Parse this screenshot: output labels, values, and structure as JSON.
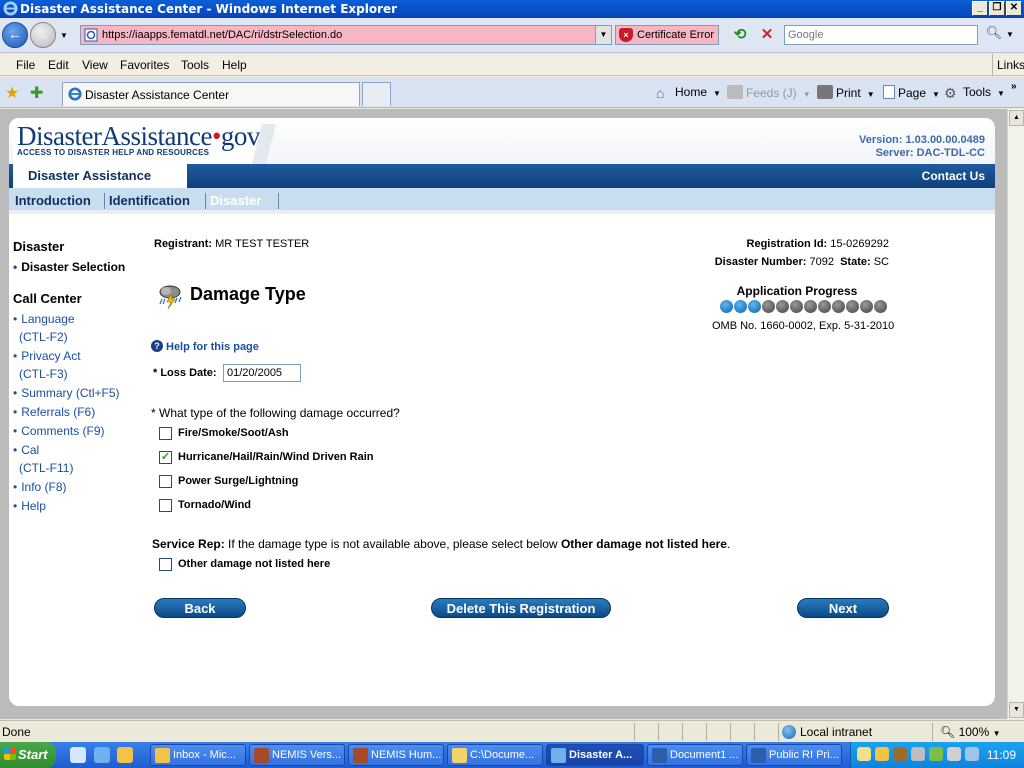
{
  "window": {
    "title": "Disaster Assistance Center - Windows Internet Explorer"
  },
  "addressbar": {
    "url": "https://iaapps.fematdl.net/DAC/ri/dstrSelection.do",
    "cert_error": "Certificate Error",
    "search_placeholder": "Google"
  },
  "menubar": {
    "items": [
      "File",
      "Edit",
      "View",
      "Favorites",
      "Tools",
      "Help"
    ],
    "links": "Links"
  },
  "tabbar": {
    "tab_title": "Disaster Assistance Center",
    "commands": {
      "home": "Home",
      "feeds": "Feeds (J)",
      "print": "Print",
      "page": "Page",
      "tools": "Tools"
    }
  },
  "site": {
    "brand_main": "DisasterAssistance",
    "brand_dot": "•",
    "brand_tld": "gov",
    "tagline": "ACCESS TO DISASTER HELP AND RESOURCES",
    "version": "Version: 1.03.00.00.0489",
    "server": "Server: DAC-TDL-CC",
    "app_tab": "Disaster Assistance",
    "contact": "Contact Us",
    "nav_tabs": [
      "Introduction",
      "Identification",
      "Disaster"
    ]
  },
  "sidebar": {
    "disaster_header": "Disaster",
    "disaster_selection": "Disaster Selection",
    "callcenter_header": "Call Center",
    "language": "Language",
    "language_key": "(CTL-F2)",
    "privacy": "Privacy Act",
    "privacy_key": "(CTL-F3)",
    "summary": "Summary (Ctl+F5)",
    "referrals": "Referrals (F6)",
    "comments": "Comments (F9)",
    "cal": "Cal",
    "cal_key": "(CTL-F11)",
    "info": "Info (F8)",
    "help": "Help"
  },
  "registration": {
    "registrant_label": "Registrant:",
    "registrant_value": "MR TEST TESTER",
    "reg_id_label": "Registration Id:",
    "reg_id_value": "15-0269292",
    "disaster_number_label": "Disaster Number:",
    "disaster_number_value": "7092",
    "state_label": "State:",
    "state_value": "SC"
  },
  "form": {
    "title": "Damage Type",
    "progress_label": "Application Progress",
    "progress": {
      "completed": 3,
      "total": 12
    },
    "omb": "OMB No. 1660-0002, Exp. 5-31-2010",
    "help_link": "Help for this page",
    "loss_date_label": "* Loss Date:",
    "loss_date_value": "01/20/2005",
    "question": "* What type of the following damage occurred?",
    "options": [
      {
        "label": "Fire/Smoke/Soot/Ash",
        "checked": false
      },
      {
        "label": "Hurricane/Hail/Rain/Wind Driven Rain",
        "checked": true
      },
      {
        "label": "Power Surge/Lightning",
        "checked": false
      },
      {
        "label": "Tornado/Wind",
        "checked": false
      }
    ],
    "service_rep_label": "Service Rep:",
    "service_rep_text": "If the damage type is not available above, please select below",
    "service_rep_bold": "Other damage not listed here",
    "service_rep_end": ".",
    "other_option": "Other damage not listed here",
    "buttons": {
      "back": "Back",
      "delete": "Delete This Registration",
      "next": "Next"
    }
  },
  "statusbar": {
    "status": "Done",
    "zone": "Local intranet",
    "zoom": "100%"
  },
  "taskbar": {
    "start": "Start",
    "buttons": [
      "Inbox - Mic...",
      "NEMIS Vers...",
      "NEMIS Hum...",
      "C:\\Docume...",
      "Disaster A...",
      "Document1 ...",
      "Public RI Pri..."
    ],
    "clock": "11:09"
  },
  "colors": {
    "brand_navy": "#0e3c79",
    "nav_blue": "#1f5b9e",
    "link_blue": "#1a4fa0",
    "address_error_pink": "#f6b6c3"
  }
}
